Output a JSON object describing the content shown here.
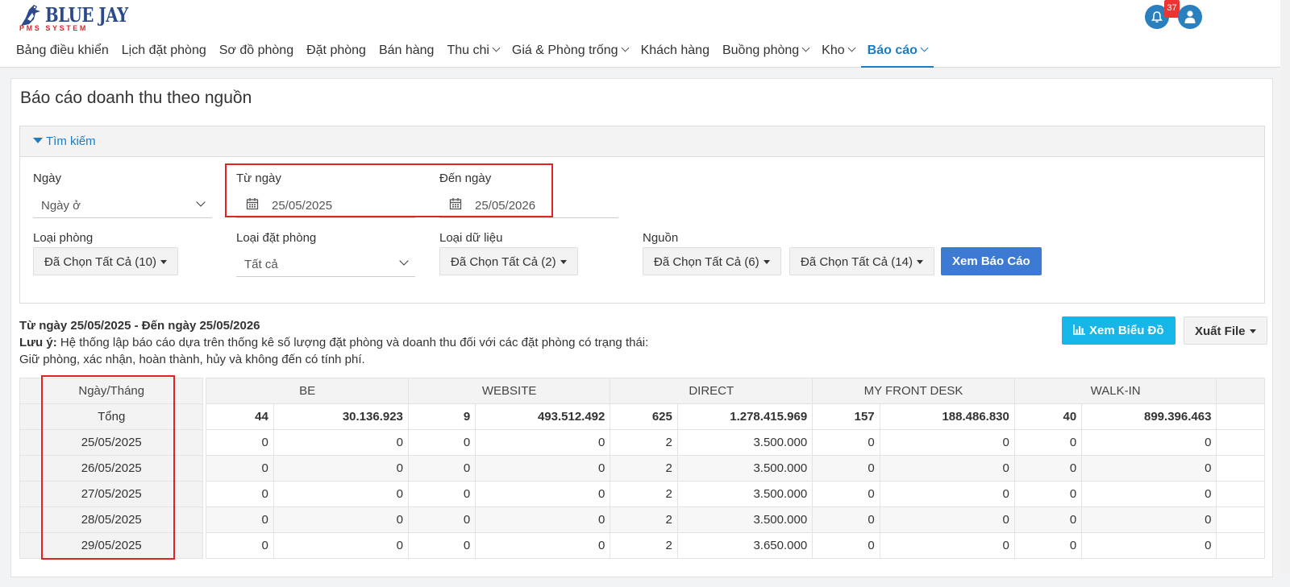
{
  "brand": {
    "name": "BLUE JAY",
    "sub": "PMS SYSTEM"
  },
  "header": {
    "notification_count": "37"
  },
  "nav": [
    {
      "label": "Bảng điều khiển",
      "dropdown": false,
      "active": false
    },
    {
      "label": "Lịch đặt phòng",
      "dropdown": false,
      "active": false
    },
    {
      "label": "Sơ đồ phòng",
      "dropdown": false,
      "active": false
    },
    {
      "label": "Đặt phòng",
      "dropdown": false,
      "active": false
    },
    {
      "label": "Bán hàng",
      "dropdown": false,
      "active": false
    },
    {
      "label": "Thu chi",
      "dropdown": true,
      "active": false
    },
    {
      "label": "Giá & Phòng trống",
      "dropdown": true,
      "active": false
    },
    {
      "label": "Khách hàng",
      "dropdown": false,
      "active": false
    },
    {
      "label": "Buồng phòng",
      "dropdown": true,
      "active": false
    },
    {
      "label": "Kho",
      "dropdown": true,
      "active": false
    },
    {
      "label": "Báo cáo",
      "dropdown": true,
      "active": true
    }
  ],
  "page": {
    "title": "Báo cáo doanh thu theo nguồn"
  },
  "search": {
    "heading": "Tìm kiếm",
    "date_type_label": "Ngày",
    "date_type_value": "Ngày ở",
    "from_label": "Từ ngày",
    "from_value": "25/05/2025",
    "to_label": "Đến ngày",
    "to_value": "25/05/2026",
    "room_type_label": "Loại phòng",
    "room_type_value": "Đã Chọn Tất Cả (10)",
    "booking_type_label": "Loại đặt phòng",
    "booking_type_value": "Tất cả",
    "data_type_label": "Loại dữ liệu",
    "data_type_value": "Đã Chọn Tất Cả (2)",
    "source_label": "Nguồn",
    "source_value_1": "Đã Chọn Tất Cả (6)",
    "source_value_2": "Đã Chọn Tất Cả (14)",
    "submit_label": "Xem Báo Cáo"
  },
  "report": {
    "range_title": "Từ ngày 25/05/2025 - Đến ngày 25/05/2026",
    "note_label": "Lưu ý:",
    "note_line1": " Hệ thống lập báo cáo dựa trên thống kê số lượng đặt phòng và doanh thu đối với các đặt phòng có trạng thái:",
    "note_line2": "Giữ phòng, xác nhận, hoàn thành, hủy và không đến có tính phí.",
    "chart_button": "Xem Biểu Đồ",
    "export_button": "Xuất File"
  },
  "table": {
    "date_header": "Ngày/Tháng",
    "total_label": "Tổng",
    "sources": [
      "BE",
      "WEBSITE",
      "DIRECT",
      "MY FRONT DESK",
      "WALK-IN"
    ],
    "totals": [
      [
        "44",
        "30.136.923"
      ],
      [
        "9",
        "493.512.492"
      ],
      [
        "625",
        "1.278.415.969"
      ],
      [
        "157",
        "188.486.830"
      ],
      [
        "40",
        "899.396.463"
      ]
    ],
    "rows": [
      {
        "date": "25/05/2025",
        "cells": [
          [
            "0",
            "0"
          ],
          [
            "0",
            "0"
          ],
          [
            "2",
            "3.500.000"
          ],
          [
            "0",
            "0"
          ],
          [
            "0",
            "0"
          ]
        ]
      },
      {
        "date": "26/05/2025",
        "cells": [
          [
            "0",
            "0"
          ],
          [
            "0",
            "0"
          ],
          [
            "2",
            "3.500.000"
          ],
          [
            "0",
            "0"
          ],
          [
            "0",
            "0"
          ]
        ]
      },
      {
        "date": "27/05/2025",
        "cells": [
          [
            "0",
            "0"
          ],
          [
            "0",
            "0"
          ],
          [
            "2",
            "3.500.000"
          ],
          [
            "0",
            "0"
          ],
          [
            "0",
            "0"
          ]
        ]
      },
      {
        "date": "28/05/2025",
        "cells": [
          [
            "0",
            "0"
          ],
          [
            "0",
            "0"
          ],
          [
            "2",
            "3.500.000"
          ],
          [
            "0",
            "0"
          ],
          [
            "0",
            "0"
          ]
        ]
      },
      {
        "date": "29/05/2025",
        "cells": [
          [
            "0",
            "0"
          ],
          [
            "0",
            "0"
          ],
          [
            "2",
            "3.650.000"
          ],
          [
            "0",
            "0"
          ],
          [
            "0",
            "0"
          ]
        ]
      }
    ]
  }
}
